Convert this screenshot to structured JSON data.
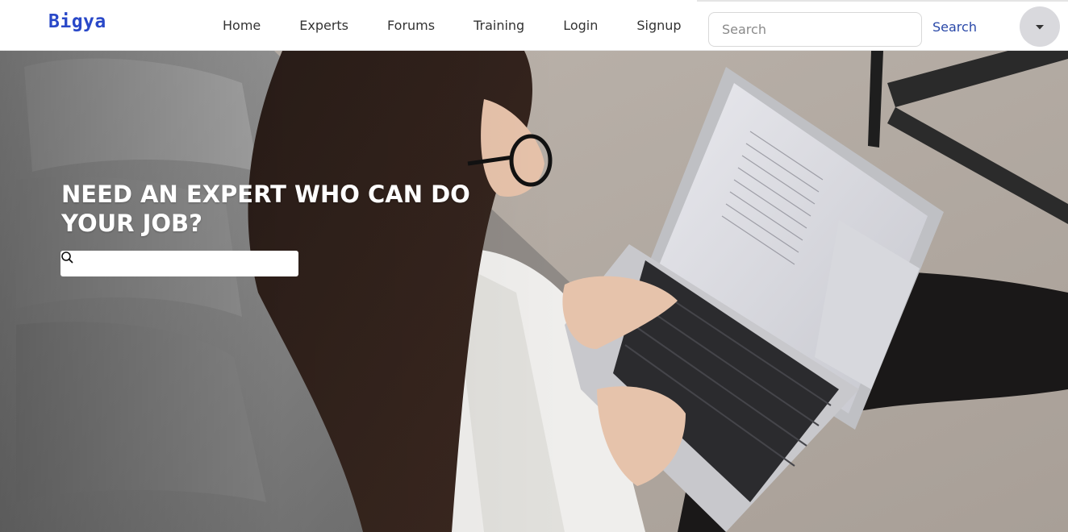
{
  "navbar": {
    "brand": "Bigya",
    "links": [
      {
        "label": "Home"
      },
      {
        "label": "Experts"
      },
      {
        "label": "Forums"
      },
      {
        "label": "Training"
      },
      {
        "label": "Login"
      },
      {
        "label": "Signup"
      }
    ],
    "search": {
      "placeholder": "Search",
      "value": "",
      "button_label": "Search"
    },
    "profile_menu": {
      "icon": "caret-down-icon"
    }
  },
  "hero": {
    "headline": "NEED AN EXPERT WHO CAN DO YOUR JOB?",
    "search": {
      "placeholder": "",
      "value": "",
      "icon": "search-icon"
    },
    "background": "woman-typing-on-laptop-photo"
  },
  "colors": {
    "brand": "#2948c8",
    "search_button": "#2948a8",
    "avatar_bg": "#d9d9dd",
    "headline": "#ffffff"
  }
}
